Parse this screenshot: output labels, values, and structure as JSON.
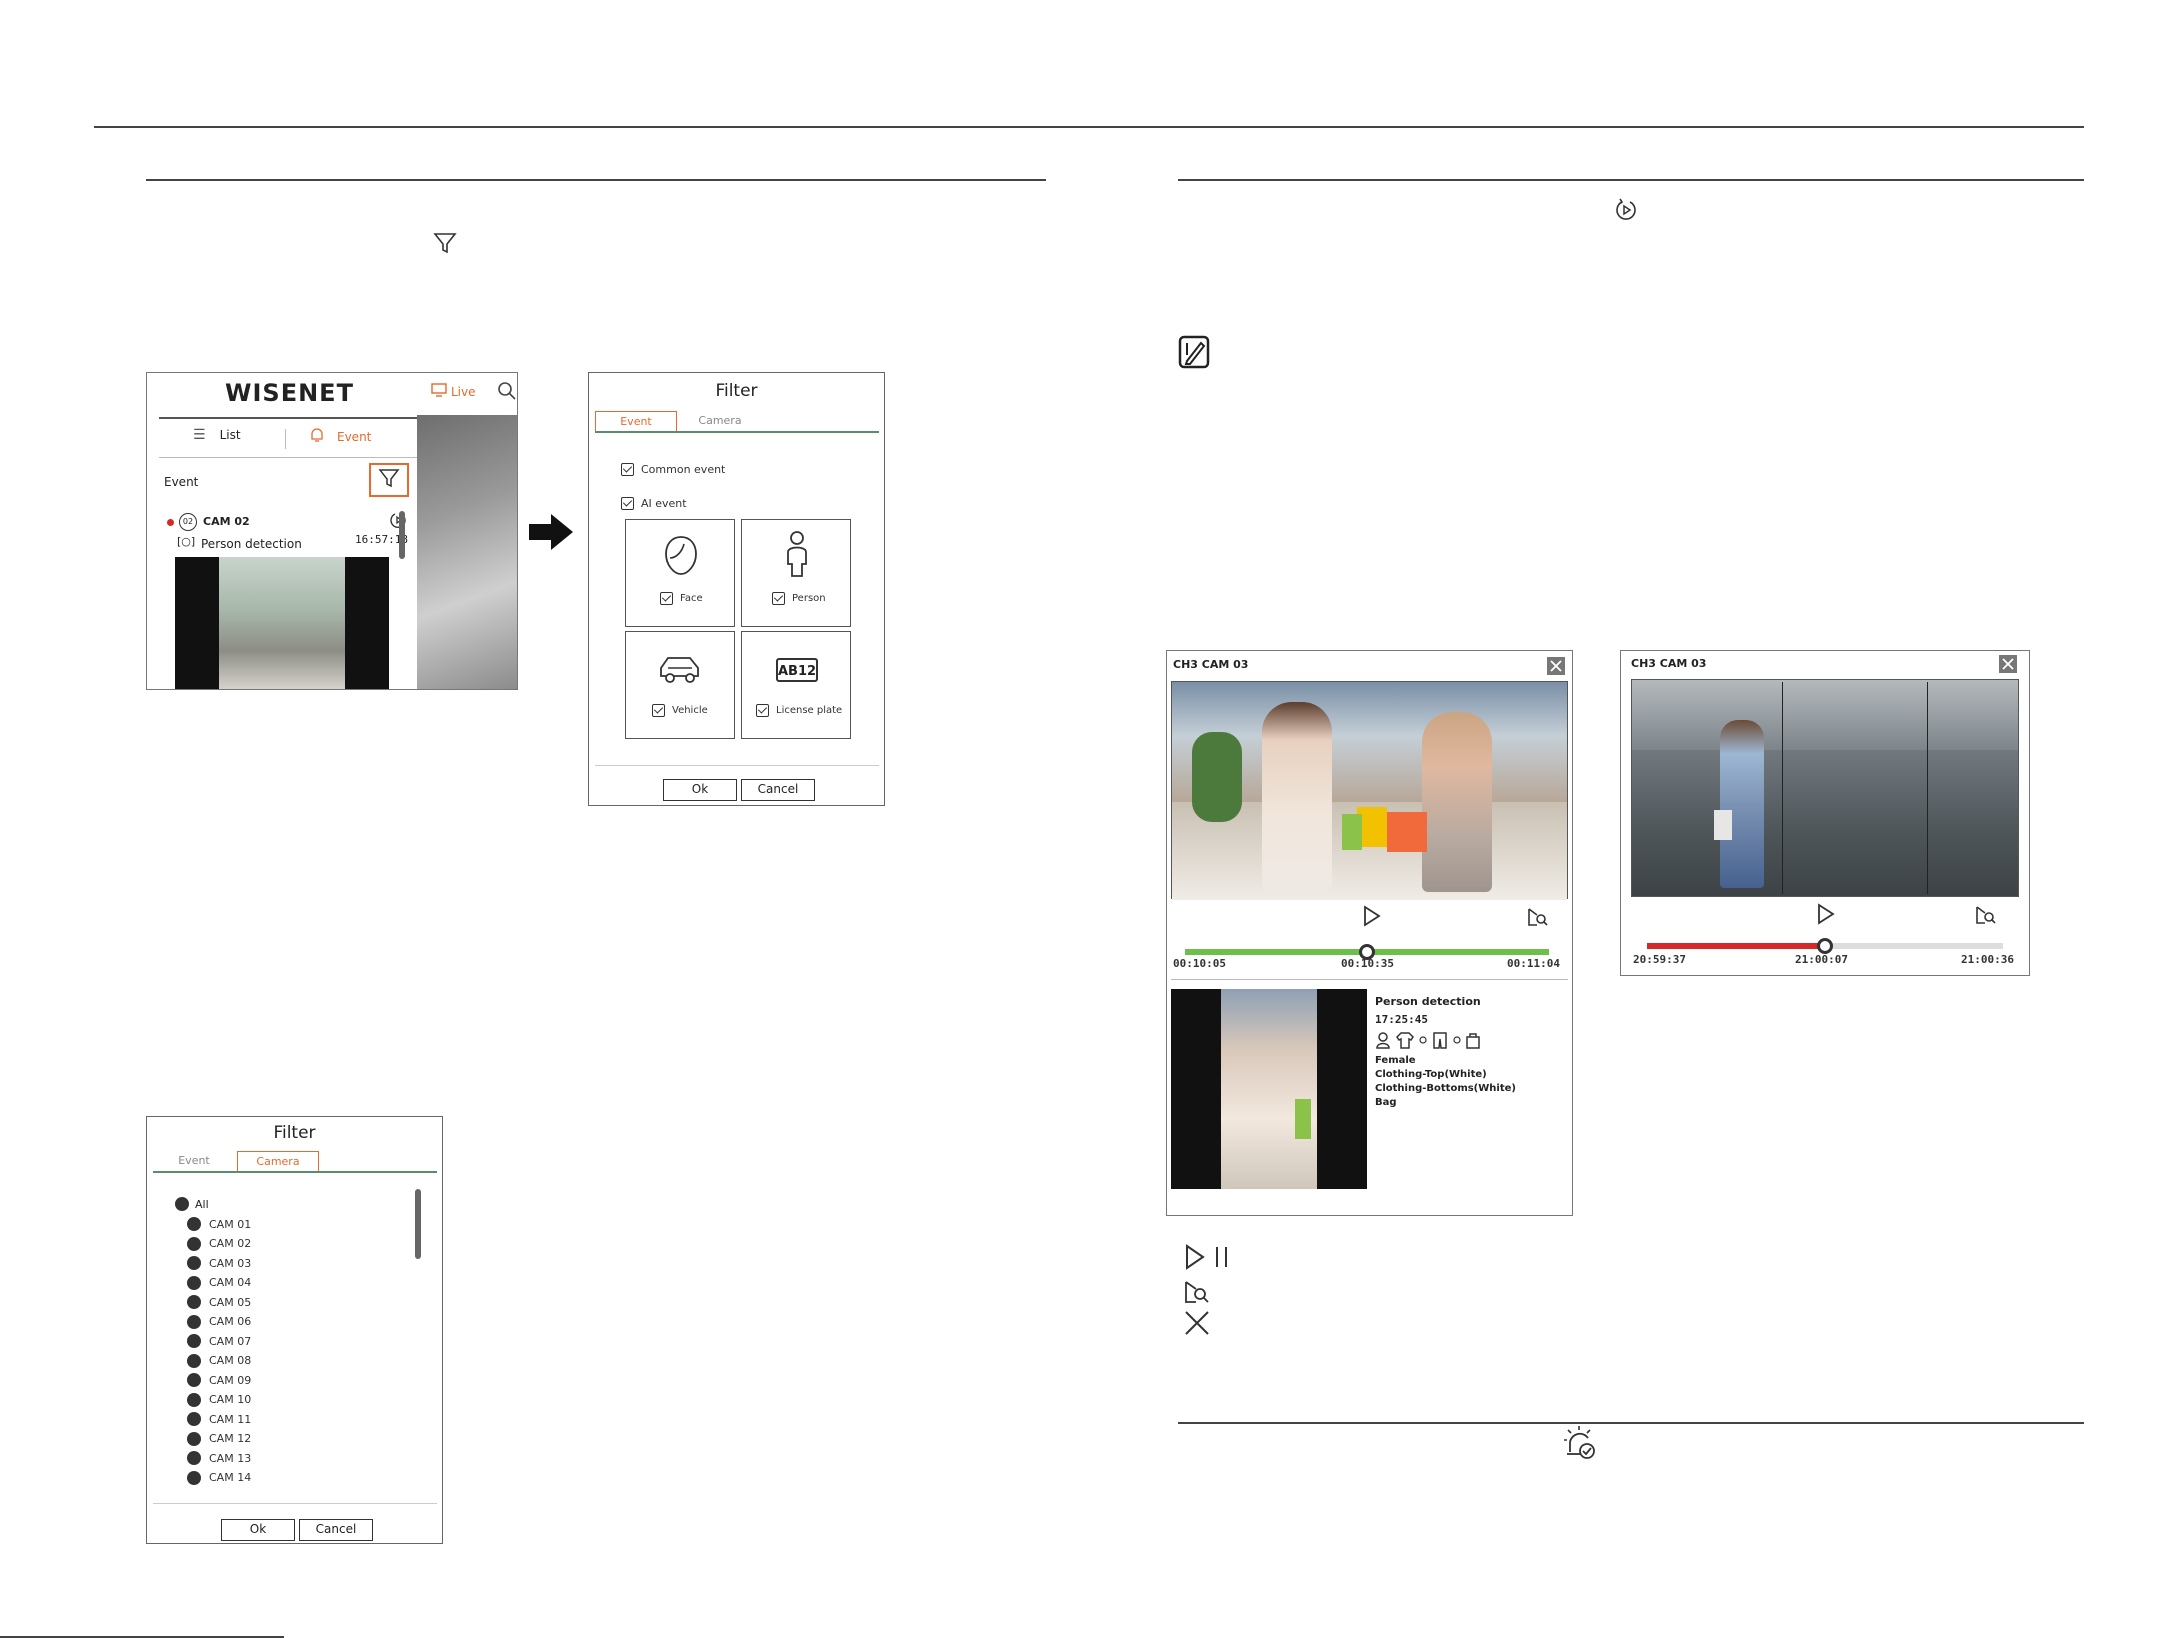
{
  "wisenet_panel": {
    "logo": "WISENET",
    "live_label": "Live",
    "tab_list": "List",
    "tab_event": "Event",
    "section_label": "Event",
    "event": {
      "channel_badge": "02",
      "camera": "CAM 02",
      "type": "Person detection",
      "time": "16:57:18"
    }
  },
  "filter_event": {
    "title": "Filter",
    "tab_event": "Event",
    "tab_camera": "Camera",
    "common_event": "Common event",
    "ai_event": "AI event",
    "tiles": [
      "Face",
      "Person",
      "Vehicle",
      "License plate"
    ],
    "plate_text": "AB12",
    "ok": "Ok",
    "cancel": "Cancel"
  },
  "filter_camera": {
    "title": "Filter",
    "tab_event": "Event",
    "tab_camera": "Camera",
    "all_label": "All",
    "cameras": [
      "CAM 01",
      "CAM 02",
      "CAM 03",
      "CAM 04",
      "CAM 05",
      "CAM 06",
      "CAM 07",
      "CAM 08",
      "CAM 09",
      "CAM 10",
      "CAM 11",
      "CAM 12",
      "CAM 13",
      "CAM 14"
    ],
    "ok": "Ok",
    "cancel": "Cancel"
  },
  "player_left": {
    "title": "CH3 CAM 03",
    "time_start": "00:10:05",
    "time_current": "00:10:35",
    "time_end": "00:11:04",
    "progress": 0.5,
    "bar_color": "#6cc04a",
    "event_type": "Person detection",
    "event_time": "17:25:45",
    "attributes": [
      "Female",
      "Clothing-Top(White)",
      "Clothing-Bottoms(White)",
      "Bag"
    ]
  },
  "player_right": {
    "title": "CH3 CAM 03",
    "time_start": "20:59:37",
    "time_current": "21:00:07",
    "time_end": "21:00:36",
    "progress": 0.5,
    "bar_color": "#d62828"
  },
  "icons": [
    "filter-icon",
    "event-playback-icon",
    "note-icon",
    "play-pause-icon",
    "zoom-search-icon",
    "close-icon",
    "alarm-check-icon"
  ],
  "colors": {
    "accent": "#e56a2c"
  }
}
